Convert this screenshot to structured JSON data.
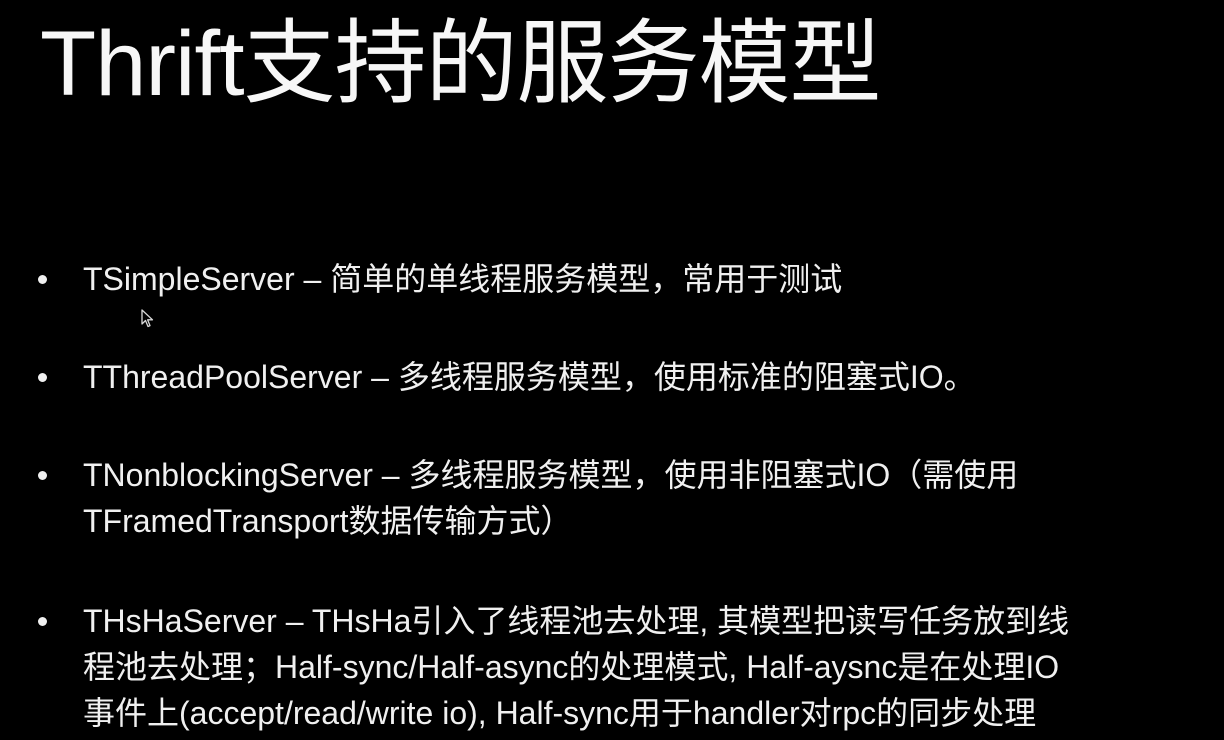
{
  "slide": {
    "title": "Thrift支持的服务模型",
    "bullets": [
      {
        "lines": [
          "TSimpleServer – 简单的单线程服务模型，常用于测试"
        ]
      },
      {
        "lines": [
          "TThreadPoolServer – 多线程服务模型，使用标准的阻塞式IO。"
        ]
      },
      {
        "lines": [
          "TNonblockingServer – 多线程服务模型，使用非阻塞式IO（需使用",
          "TFramedTransport数据传输方式）"
        ]
      },
      {
        "lines": [
          "THsHaServer – THsHa引入了线程池去处理, 其模型把读写任务放到线",
          "程池去处理；Half-sync/Half-async的处理模式, Half-aysnc是在处理IO",
          "事件上(accept/read/write io), Half-sync用于handler对rpc的同步处理"
        ]
      }
    ]
  },
  "colors": {
    "background": "#000000",
    "text": "#f0f0f0"
  },
  "icons": {
    "cursor": "mouse-pointer-icon"
  }
}
